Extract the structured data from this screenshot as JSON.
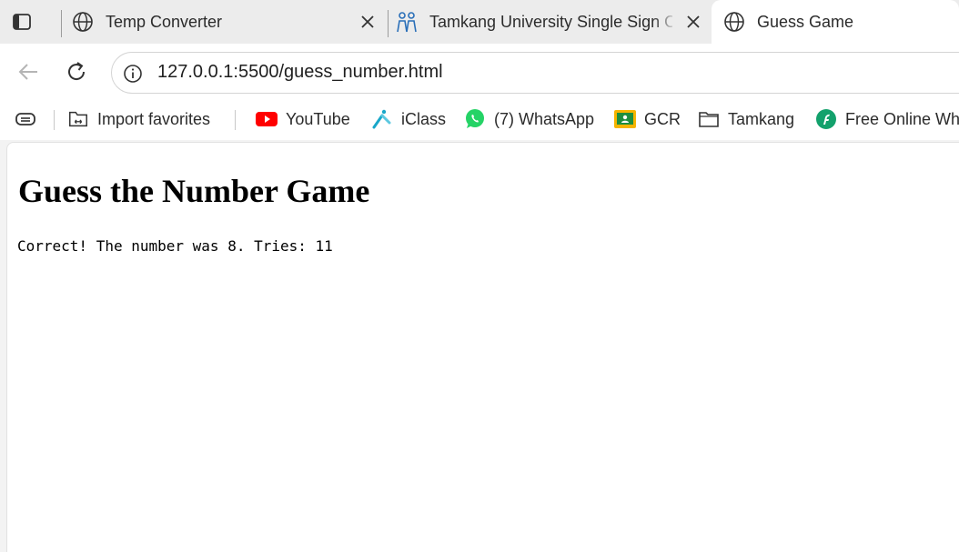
{
  "browser": {
    "tabs": [
      {
        "title": "Temp Converter",
        "icon": "globe-icon",
        "active": false
      },
      {
        "title": "Tamkang University Single Sign O",
        "icon": "tamkang-logo-icon",
        "active": false
      },
      {
        "title": "Guess Game",
        "icon": "globe-icon",
        "active": true
      }
    ],
    "address": {
      "url": "127.0.0.1:5500/guess_number.html"
    },
    "bookmarks": [
      {
        "label": "Import favorites",
        "icon": "import-favorites-icon"
      },
      {
        "label": "YouTube",
        "icon": "youtube-icon"
      },
      {
        "label": "iClass",
        "icon": "iclass-icon"
      },
      {
        "label": "(7) WhatsApp",
        "icon": "whatsapp-icon"
      },
      {
        "label": "GCR",
        "icon": "google-classroom-icon"
      },
      {
        "label": "Tamkang",
        "icon": "folder-icon"
      },
      {
        "label": "Free Online Whi",
        "icon": "whiteboard-icon"
      }
    ]
  },
  "page": {
    "heading": "Guess the Number Game",
    "result": "Correct! The number was 8. Tries: 11"
  },
  "colors": {
    "youtube": "#ff0000",
    "whatsapp": "#25d366",
    "gcr": "#f5b400",
    "iclass": "#19a7c9",
    "whiteboard": "#13a16c"
  }
}
